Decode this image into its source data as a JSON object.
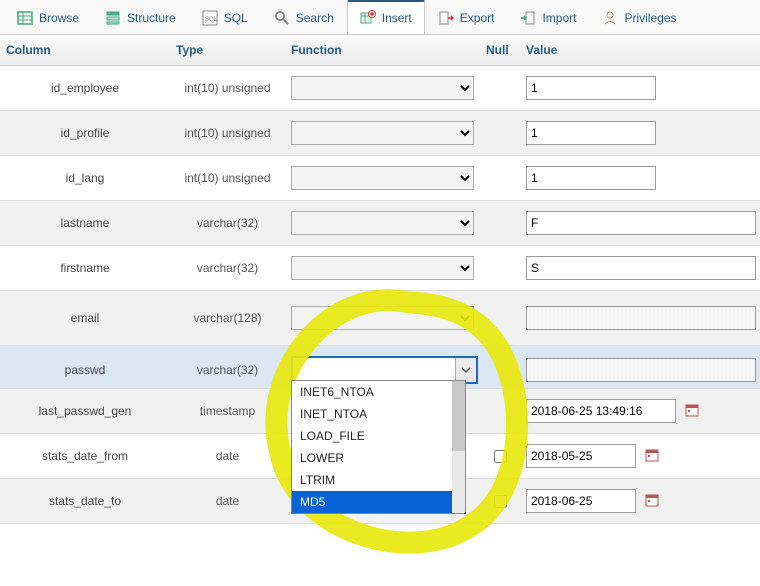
{
  "tabs": {
    "browse": "Browse",
    "structure": "Structure",
    "sql": "SQL",
    "search": "Search",
    "insert": "Insert",
    "export": "Export",
    "import": "Import",
    "privileges": "Privileges"
  },
  "headers": {
    "column": "Column",
    "type": "Type",
    "function": "Function",
    "null": "Null",
    "value": "Value"
  },
  "rows": {
    "r0": {
      "column": "id_employee",
      "type": "int(10) unsigned",
      "value": "1"
    },
    "r1": {
      "column": "id_profile",
      "type": "int(10) unsigned",
      "value": "1"
    },
    "r2": {
      "column": "id_lang",
      "type": "int(10) unsigned",
      "value": "1"
    },
    "r3": {
      "column": "lastname",
      "type": "varchar(32)",
      "value": "F"
    },
    "r4": {
      "column": "firstname",
      "type": "varchar(32)",
      "value": "S"
    },
    "r5": {
      "column": "email",
      "type": "varchar(128)",
      "value": ""
    },
    "r6": {
      "column": "passwd",
      "type": "varchar(32)",
      "value": ""
    },
    "r7": {
      "column": "last_passwd_gen",
      "type": "timestamp",
      "value": "2018-06-25 13:49:16"
    },
    "r8": {
      "column": "stats_date_from",
      "type": "date",
      "value": "2018-05-25"
    },
    "r9": {
      "column": "stats_date_to",
      "type": "date",
      "value": "2018-06-25"
    }
  },
  "dropdown": {
    "opt0": "INET6_NTOA",
    "opt1": "INET_NTOA",
    "opt2": "LOAD_FILE",
    "opt3": "LOWER",
    "opt4": "LTRIM",
    "opt5": "MD5"
  }
}
